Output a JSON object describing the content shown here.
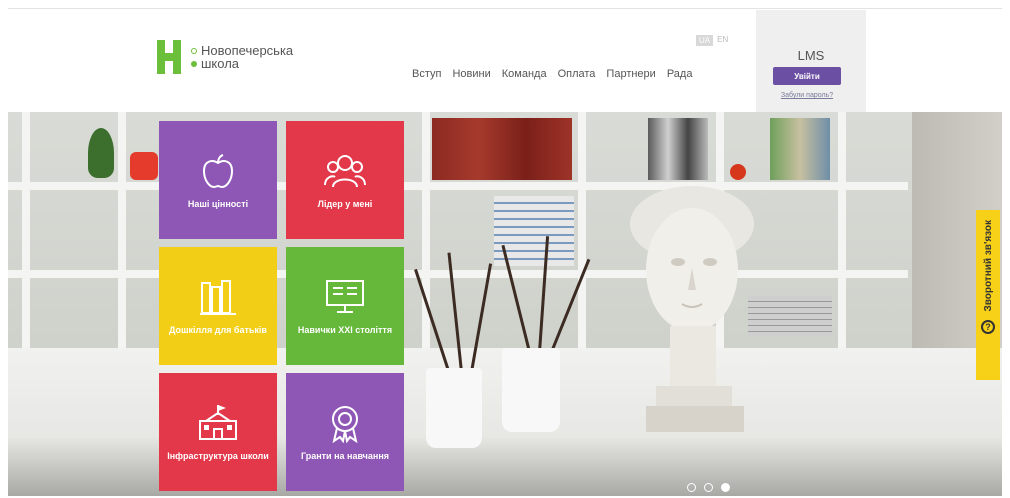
{
  "header": {
    "logo_line1": "Новопечерська",
    "logo_line2": "школа",
    "nav": [
      "Вступ",
      "Новини",
      "Команда",
      "Оплата",
      "Партнери",
      "Рада"
    ],
    "lang": {
      "active": "UA",
      "other": "EN"
    }
  },
  "lms": {
    "title": "LMS",
    "login_label": "Увійти",
    "forgot_label": "Забули пароль?"
  },
  "tiles": [
    {
      "label": "Наші цінності",
      "icon": "apple-icon",
      "color": "#8e57b5"
    },
    {
      "label": "Лідер у мені",
      "icon": "people-icon",
      "color": "#e2384a"
    },
    {
      "label": "Дошкілля для батьків",
      "icon": "books-icon",
      "color": "#f2cf16"
    },
    {
      "label": "Навички XXI століття",
      "icon": "monitor-icon",
      "color": "#65b83a"
    },
    {
      "label": "Інфраструктура школи",
      "icon": "school-building-icon",
      "color": "#e2384a"
    },
    {
      "label": "Гранти на навчання",
      "icon": "award-icon",
      "color": "#8e57b5"
    }
  ],
  "carousel": {
    "count": 3,
    "active": 3
  },
  "feedback": {
    "label": "Зворотний зв'язок",
    "icon": "question-icon"
  }
}
